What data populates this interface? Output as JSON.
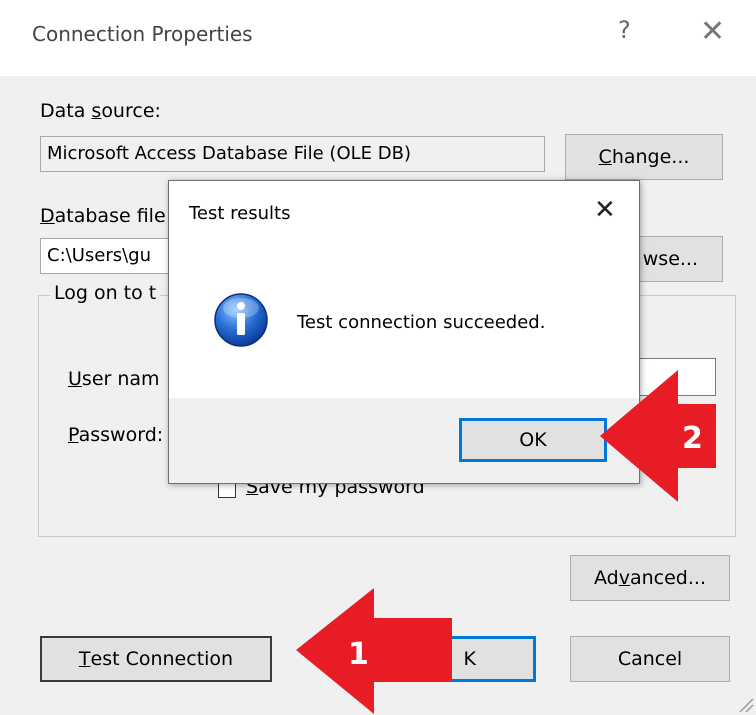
{
  "window": {
    "title": "Connection Properties",
    "help_label": "?",
    "close_label": "✕"
  },
  "data_source": {
    "label_pre": "Data ",
    "label_u": "s",
    "label_post": "ource:",
    "value": "Microsoft Access Database File (OLE DB)",
    "change_button_u": "C",
    "change_button_post": "hange..."
  },
  "database_file": {
    "label_u": "D",
    "label_post": "atabase file",
    "value": "C:\\Users\\gu",
    "browse_button_tail": "wse..."
  },
  "logon_group": {
    "legend": "Log on to t",
    "user_name_u": "U",
    "user_name_post": "ser nam",
    "password_u": "P",
    "password_post": "assword:",
    "save_password_u": "S",
    "save_password_post": "ave my password"
  },
  "buttons": {
    "advanced_pre": "Ad",
    "advanced_u": "v",
    "advanced_post": "anced...",
    "test_connection_u": "T",
    "test_connection_post": "est Connection",
    "ok_partial": "K",
    "cancel": "Cancel"
  },
  "popup": {
    "title": "Test results",
    "close_label": "✕",
    "message": "Test connection succeeded.",
    "ok_label": "OK",
    "icon": "info-icon"
  },
  "annotations": {
    "arrow_1_label": "1",
    "arrow_2_label": "2",
    "arrow_color": "#e81c24"
  }
}
